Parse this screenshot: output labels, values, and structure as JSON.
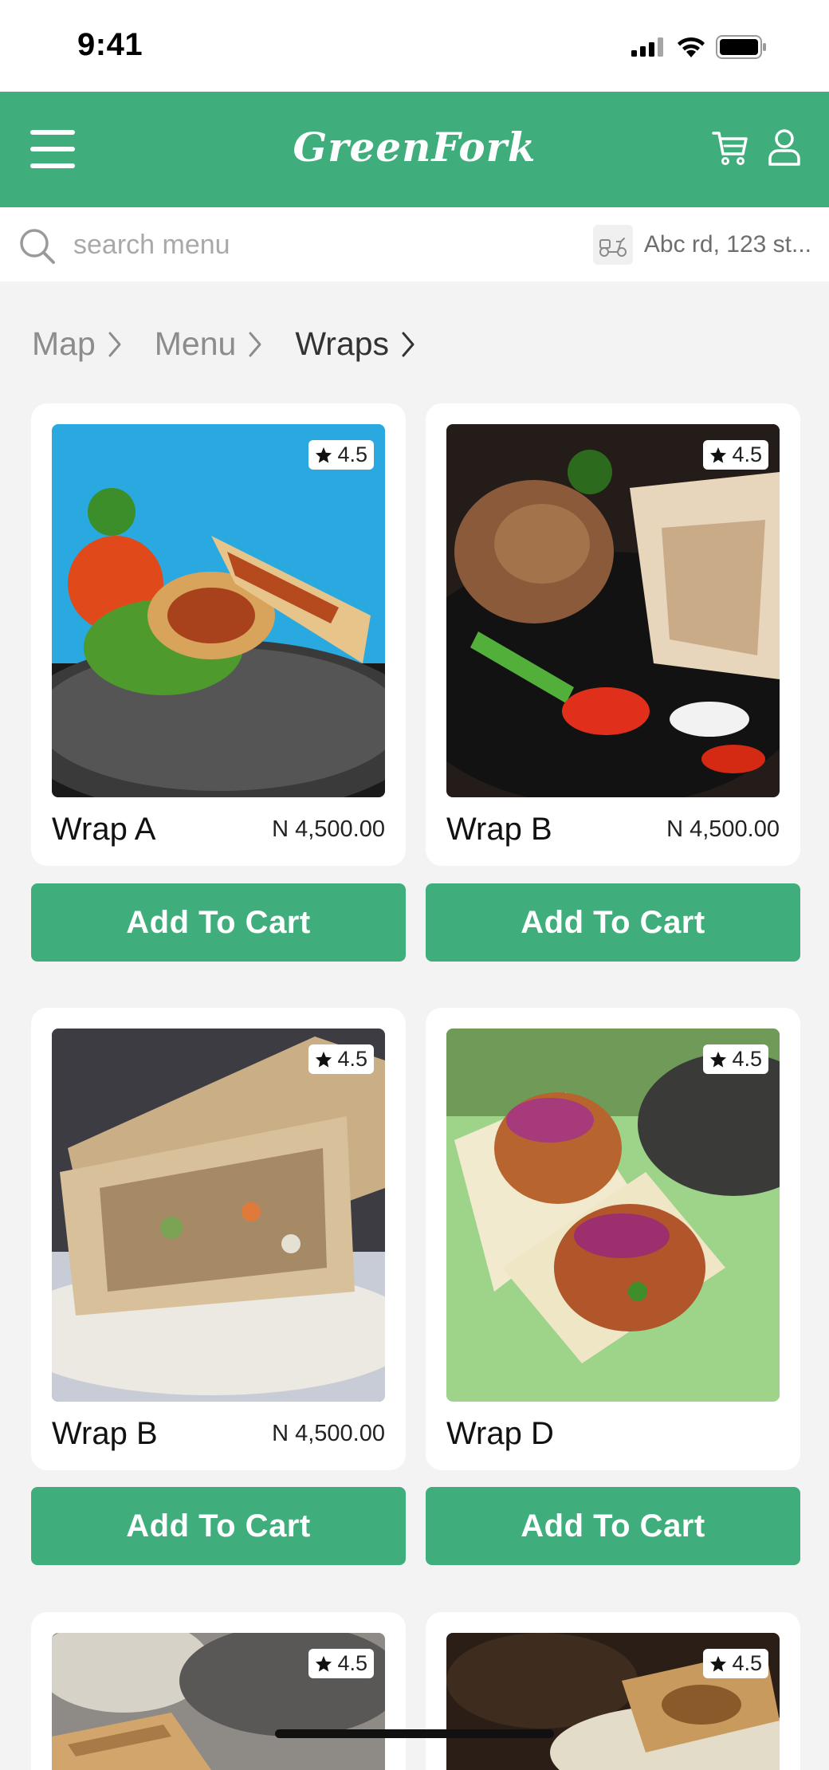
{
  "status_bar": {
    "time": "9:41"
  },
  "header": {
    "brand": "GreenFork"
  },
  "search": {
    "placeholder": "search menu",
    "location": "Abc rd, 123 st..."
  },
  "breadcrumb": [
    {
      "label": "Map"
    },
    {
      "label": "Menu"
    },
    {
      "label": "Wraps"
    }
  ],
  "items": [
    {
      "name": "Wrap A",
      "price": "N 4,500.00",
      "rating": "4.5",
      "button": "Add To Cart"
    },
    {
      "name": "Wrap B",
      "price": "N 4,500.00",
      "rating": "4.5",
      "button": "Add To Cart"
    },
    {
      "name": "Wrap B",
      "price": "N 4,500.00",
      "rating": "4.5",
      "button": "Add To Cart"
    },
    {
      "name": "Wrap D",
      "price": "",
      "rating": "4.5",
      "button": "Add To Cart"
    },
    {
      "name": "",
      "price": "",
      "rating": "4.5",
      "button": ""
    },
    {
      "name": "",
      "price": "",
      "rating": "4.5",
      "button": ""
    }
  ],
  "colors": {
    "brand": "#40ae7c",
    "background": "#f3f3f3"
  },
  "icons": [
    "menu-icon",
    "cart-icon",
    "profile-icon",
    "search-icon",
    "scooter-icon",
    "chevron-right-icon",
    "star-icon"
  ]
}
